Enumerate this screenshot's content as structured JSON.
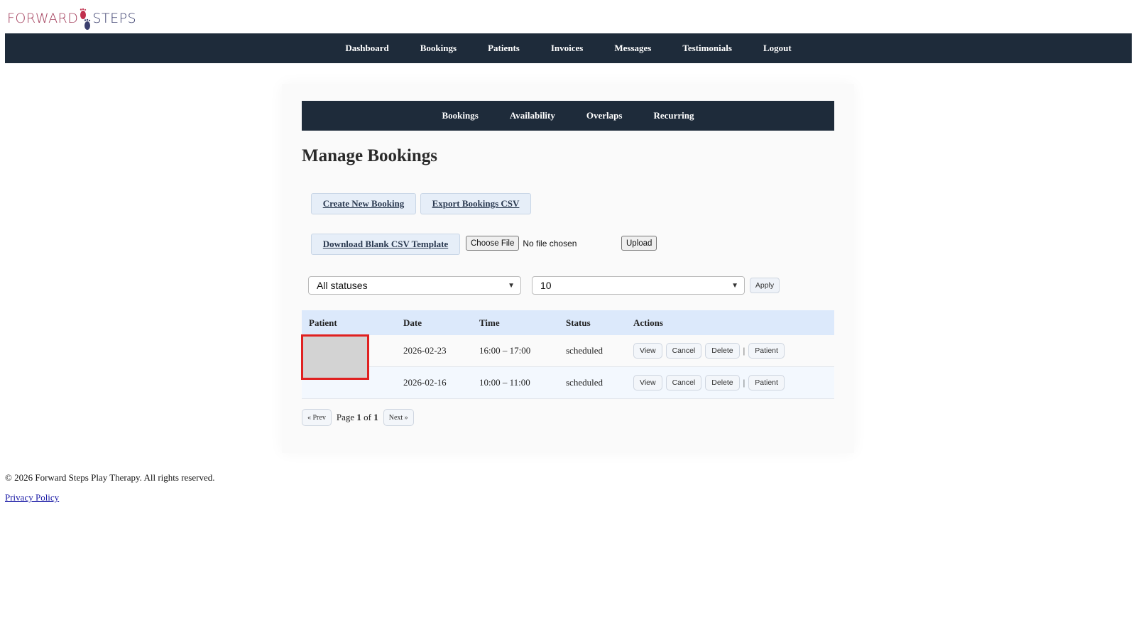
{
  "logo": {
    "part1": "FORWARD",
    "part2": "STEPS"
  },
  "topnav": [
    "Dashboard",
    "Bookings",
    "Patients",
    "Invoices",
    "Messages",
    "Testimonials",
    "Logout"
  ],
  "subnav": [
    "Bookings",
    "Availability",
    "Overlaps",
    "Recurring"
  ],
  "page_title": "Manage Bookings",
  "actions": {
    "create": "Create New Booking",
    "export": "Export Bookings CSV",
    "template": "Download Blank CSV Template",
    "choose_file": "Choose File",
    "file_status": "No file chosen",
    "upload": "Upload"
  },
  "filters": {
    "status": "All statuses",
    "per_page": "10",
    "apply": "Apply"
  },
  "table": {
    "headers": [
      "Patient",
      "Date",
      "Time",
      "Status",
      "Actions"
    ],
    "rows": [
      {
        "patient": "",
        "date": "2026-02-23",
        "time": "16:00 – 17:00",
        "status": "scheduled"
      },
      {
        "patient": "",
        "date": "2026-02-16",
        "time": "10:00 – 11:00",
        "status": "scheduled"
      }
    ],
    "row_actions": {
      "view": "View",
      "cancel": "Cancel",
      "delete": "Delete",
      "separator": "|",
      "patient": "Patient"
    }
  },
  "pagination": {
    "prev": "« Prev",
    "page_word": "Page",
    "current": "1",
    "of_word": "of",
    "total": "1",
    "next": "Next »"
  },
  "footer": {
    "copyright": "© 2026 Forward Steps Play Therapy. All rights reserved.",
    "privacy": "Privacy Policy"
  },
  "colors": {
    "nav_bg": "#1e2b3a",
    "logo_pink": "#a4405d",
    "logo_navy": "#3b3f6e",
    "header_row": "#dce9fb",
    "redaction_border": "#e02020"
  }
}
